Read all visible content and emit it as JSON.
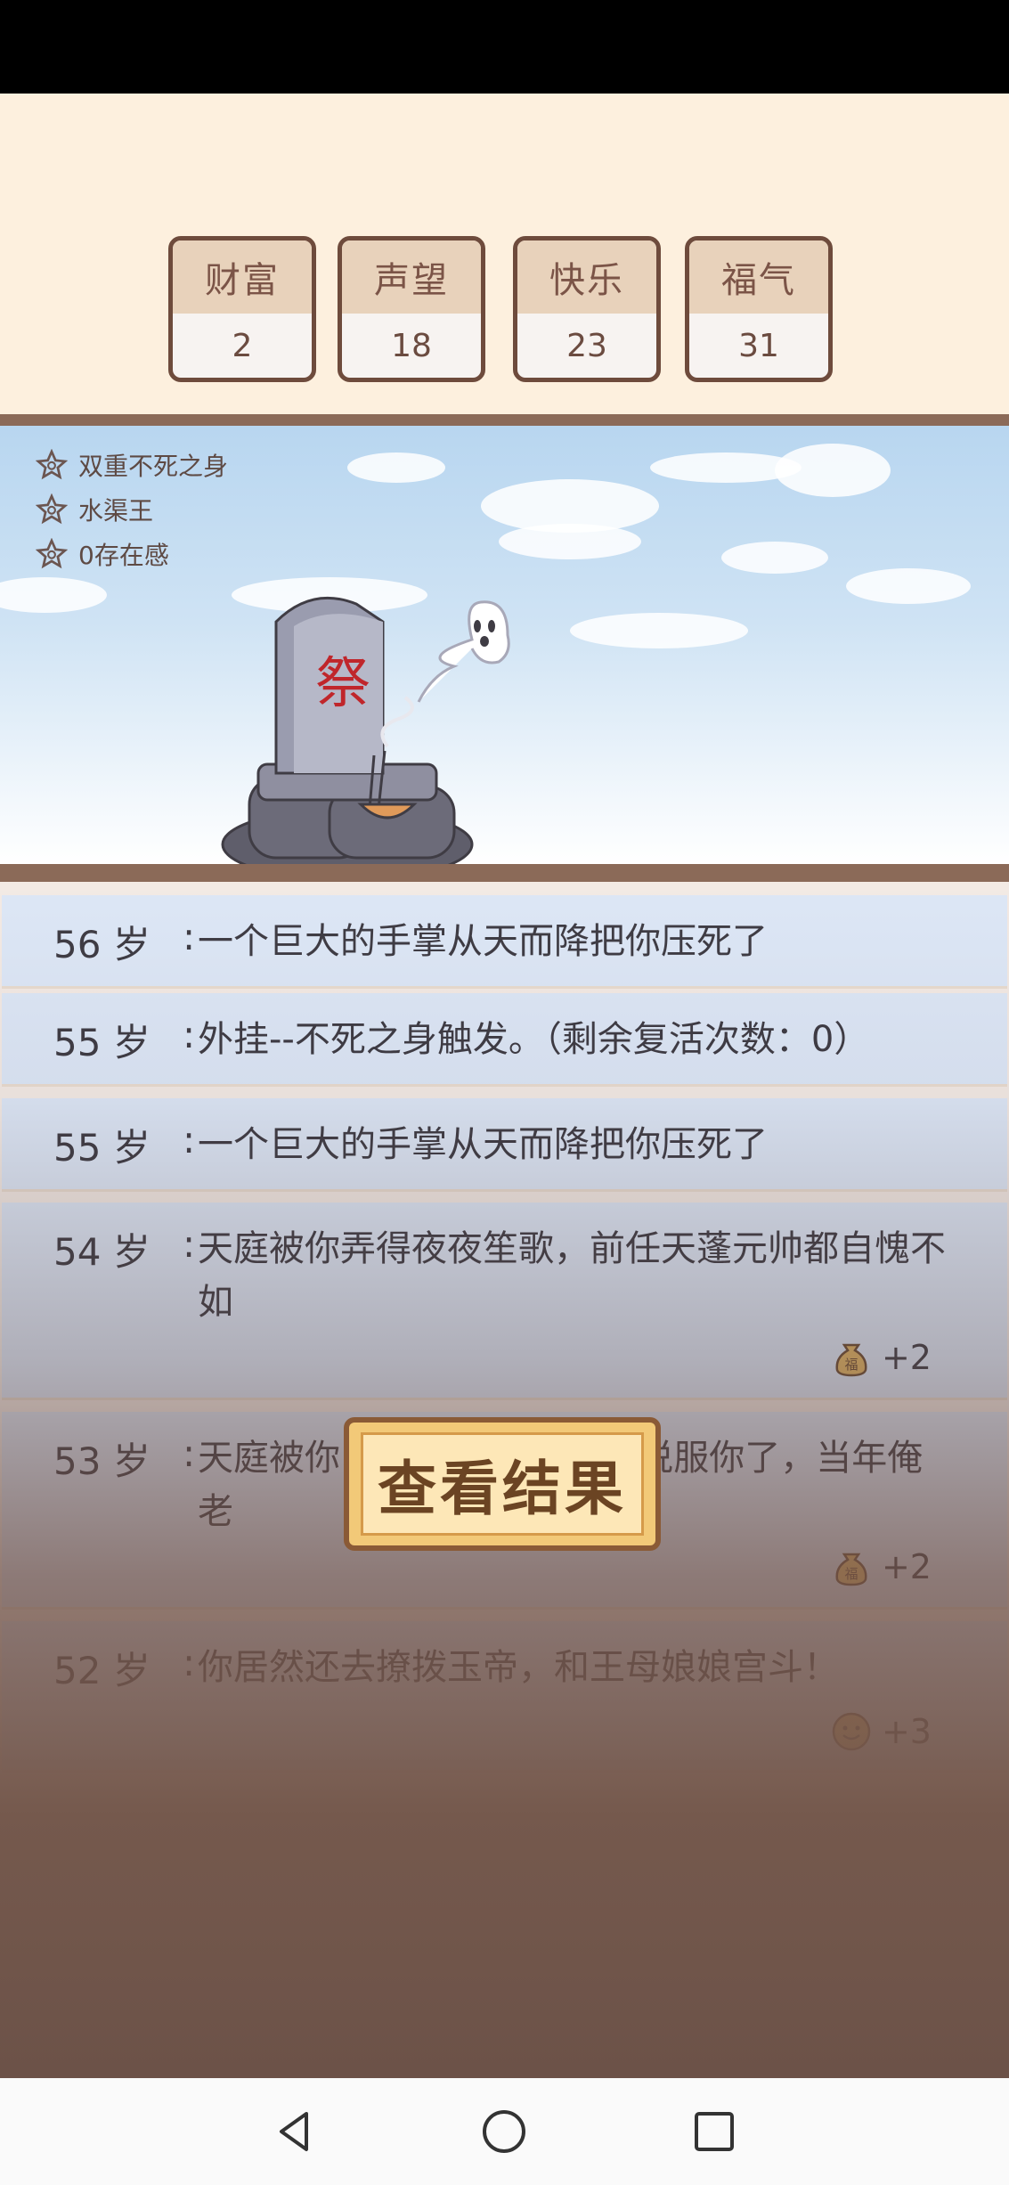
{
  "stats": [
    {
      "label": "财富",
      "value": "2"
    },
    {
      "label": "声望",
      "value": "18"
    },
    {
      "label": "快乐",
      "value": "23"
    },
    {
      "label": "福气",
      "value": "31"
    }
  ],
  "traits": [
    "双重不死之身",
    "水渠王",
    "0存在感"
  ],
  "tombstone_glyph": "祭",
  "log": [
    {
      "age": "56",
      "unit": "岁",
      "event": "一个巨大的手掌从天而降把你压死了"
    },
    {
      "age": "55",
      "unit": "岁",
      "event": "外挂--不死之身触发。（剩余复活次数：0）"
    },
    {
      "age": "55",
      "unit": "岁",
      "event": "一个巨大的手掌从天而降把你压死了"
    },
    {
      "age": "54",
      "unit": "岁",
      "event": "天庭被你弄得夜夜笙歌，前任天蓬元帅都自愧不如",
      "reward_icon": "fortune-bag-icon",
      "reward_glyph": "福",
      "reward": "+2"
    },
    {
      "age": "53",
      "unit": "岁",
      "event": "天庭被你                    哥都说服你了，当年俺老",
      "reward_icon": "fortune-bag-icon",
      "reward_glyph": "福",
      "reward": "+2"
    },
    {
      "age": "52",
      "unit": "岁",
      "event": "你居然还去撩拨玉帝，和王母娘娘宫斗！",
      "reward_icon": "smile-icon",
      "reward": "+3"
    }
  ],
  "result_button": "查看结果",
  "colors": {
    "accent": "#8a5a36",
    "tomb_glyph": "#c0262b",
    "log_bg": "#dde7f6"
  }
}
